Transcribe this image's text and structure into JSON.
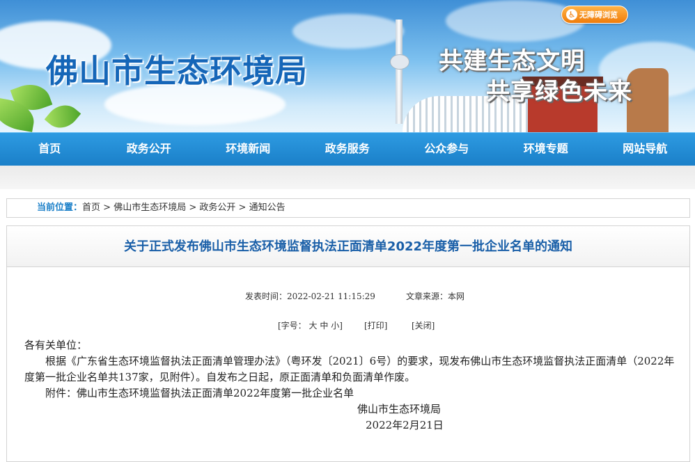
{
  "banner": {
    "title": "佛山市生态环境局",
    "slogan_line1": "共建生态文明",
    "slogan_line2": "共享绿色未来",
    "accessibility_label": "无障碍浏览"
  },
  "nav": {
    "items": [
      "首页",
      "政务公开",
      "环境新闻",
      "政务服务",
      "公众参与",
      "环境专题",
      "网站导航"
    ]
  },
  "breadcrumb": {
    "label": "当前位置：",
    "items": [
      "首页",
      "佛山市生态环境局",
      "政务公开",
      "通知公告"
    ],
    "separator": " > "
  },
  "article": {
    "title": "关于正式发布佛山市生态环境监督执法正面清单2022年度第一批企业名单的通知",
    "publish_time": "发表时间：2022-02-21 11:15:29",
    "source": "文章来源：本网",
    "font_size_label": "[字号：",
    "font_sizes": [
      "大",
      "中",
      "小"
    ],
    "font_size_close": "]",
    "print_label": "[打印]",
    "close_label": "[关闭]",
    "salutation": "各有关单位：",
    "paragraph1": "根据《广东省生态环境监督执法正面清单管理办法》（粤环发〔2021〕6号）的要求，现发布佛山市生态环境监督执法正面清单（2022年度第一批企业名单共137家，见附件）。自发布之日起，原正面清单和负面清单作废。",
    "attachment": "附件：佛山市生态环境监督执法正面清单2022年度第一批企业名单",
    "signature": "佛山市生态环境局",
    "date": "2022年2月21日"
  },
  "colors": {
    "nav_bg": "#1a7fc8",
    "title_blue": "#1a5fa8",
    "accent_orange": "#f07c0a"
  }
}
